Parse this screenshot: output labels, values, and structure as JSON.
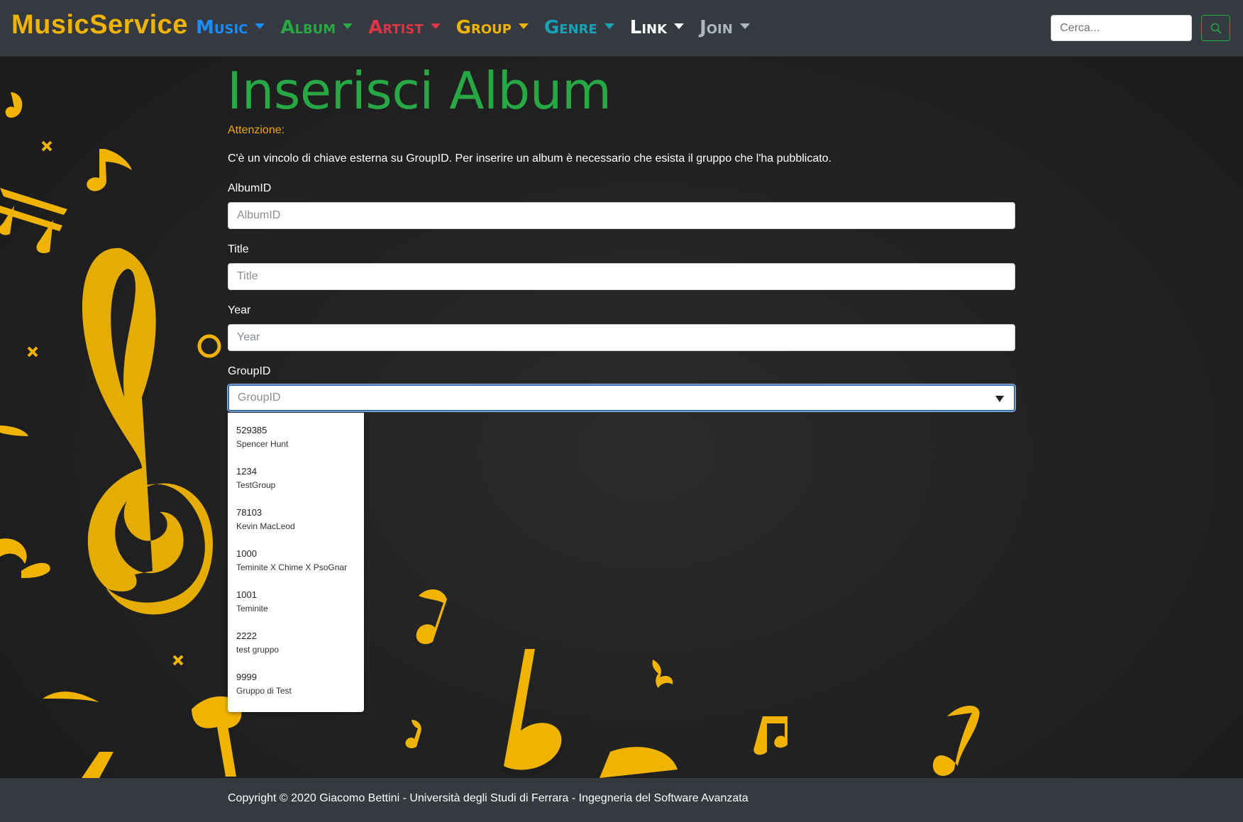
{
  "navbar": {
    "brand": "MusicService",
    "menu": [
      {
        "label": "Music",
        "color": "#1a8cff"
      },
      {
        "label": "Album",
        "color": "#28a745"
      },
      {
        "label": "Artist",
        "color": "#dc3545"
      },
      {
        "label": "Group",
        "color": "#f0b400"
      },
      {
        "label": "Genre",
        "color": "#17a2b8"
      },
      {
        "label": "Link",
        "color": "#ffffff"
      },
      {
        "label": "Join",
        "color": "#adb5bd"
      }
    ],
    "search_placeholder": "Cerca...",
    "search_icon": "search-icon"
  },
  "main": {
    "title": "Inserisci Album",
    "warning_label": "Attenzione:",
    "notice": "C'è un vincolo di chiave esterna su GroupID. Per inserire un album è necessario che esista il gruppo che l'ha pubblicato.",
    "fields": {
      "albumid": {
        "label": "AlbumID",
        "placeholder": "AlbumID",
        "value": ""
      },
      "title": {
        "label": "Title",
        "placeholder": "Title",
        "value": ""
      },
      "year": {
        "label": "Year",
        "placeholder": "Year",
        "value": ""
      },
      "groupid": {
        "label": "GroupID",
        "placeholder": "GroupID"
      }
    },
    "group_options": [
      {
        "id": "529385",
        "name": "Spencer Hunt"
      },
      {
        "id": "1234",
        "name": "TestGroup"
      },
      {
        "id": "78103",
        "name": "Kevin MacLeod"
      },
      {
        "id": "1000",
        "name": "Teminite X Chime X PsoGnar"
      },
      {
        "id": "1001",
        "name": "Teminite"
      },
      {
        "id": "2222",
        "name": "test gruppo"
      },
      {
        "id": "9999",
        "name": "Gruppo di Test"
      }
    ]
  },
  "footer": {
    "copyright": "Copyright © 2020 Giacomo Bettini - Università degli Studi di Ferrara - Ingegneria del Software Avanzata"
  },
  "colors": {
    "accent_green": "#28a745",
    "warning_orange": "#f0a500",
    "note_gold": "#f0b400",
    "navbar_bg": "#343a40"
  }
}
